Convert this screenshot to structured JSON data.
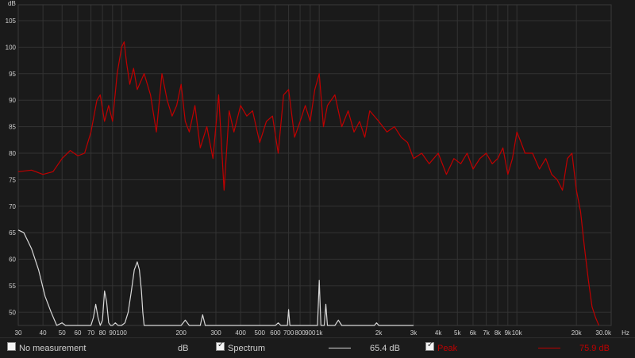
{
  "chart_data": {
    "type": "line",
    "xscale": "log",
    "xlim": [
      30,
      30000
    ],
    "ylim": [
      47.5,
      108
    ],
    "yunit": "dB",
    "xunit": "Hz",
    "grid": true,
    "xticks": [
      {
        "v": 30,
        "label": "30"
      },
      {
        "v": 40,
        "label": "40"
      },
      {
        "v": 50,
        "label": "50"
      },
      {
        "v": 60,
        "label": "60"
      },
      {
        "v": 70,
        "label": "70"
      },
      {
        "v": 80,
        "label": "80"
      },
      {
        "v": 90,
        "label": "90"
      },
      {
        "v": 100,
        "label": "100"
      },
      {
        "v": 200,
        "label": "200"
      },
      {
        "v": 300,
        "label": "300"
      },
      {
        "v": 400,
        "label": "400"
      },
      {
        "v": 500,
        "label": "500"
      },
      {
        "v": 600,
        "label": "600"
      },
      {
        "v": 700,
        "label": "700"
      },
      {
        "v": 800,
        "label": "800"
      },
      {
        "v": 900,
        "label": "900"
      },
      {
        "v": 1000,
        "label": "1k"
      },
      {
        "v": 2000,
        "label": "2k"
      },
      {
        "v": 3000,
        "label": "3k"
      },
      {
        "v": 4000,
        "label": "4k"
      },
      {
        "v": 5000,
        "label": "5k"
      },
      {
        "v": 6000,
        "label": "6k"
      },
      {
        "v": 7000,
        "label": "7k"
      },
      {
        "v": 8000,
        "label": "8k"
      },
      {
        "v": 9000,
        "label": "9k"
      },
      {
        "v": 10000,
        "label": "10k"
      },
      {
        "v": 20000,
        "label": "20k"
      },
      {
        "v": 30000,
        "label": "30.0k"
      }
    ],
    "yticks": [
      50,
      55,
      60,
      65,
      70,
      75,
      80,
      85,
      90,
      95,
      100,
      105
    ],
    "series": [
      {
        "name": "Peak",
        "color": "#c00000",
        "x": [
          30,
          35,
          40,
          45,
          50,
          55,
          60,
          65,
          70,
          75,
          78,
          82,
          86,
          90,
          95,
          100,
          103,
          106,
          110,
          115,
          120,
          130,
          140,
          150,
          160,
          170,
          180,
          190,
          200,
          210,
          220,
          235,
          250,
          270,
          290,
          310,
          330,
          350,
          370,
          400,
          430,
          460,
          500,
          540,
          580,
          620,
          660,
          700,
          750,
          800,
          850,
          900,
          950,
          1000,
          1050,
          1100,
          1200,
          1300,
          1400,
          1500,
          1600,
          1700,
          1800,
          2000,
          2200,
          2400,
          2600,
          2800,
          3000,
          3300,
          3600,
          4000,
          4400,
          4800,
          5200,
          5600,
          6000,
          6500,
          7000,
          7500,
          8000,
          8500,
          9000,
          9500,
          10000,
          10500,
          11000,
          12000,
          13000,
          14000,
          15000,
          16000,
          17000,
          18000,
          19000,
          20000,
          21000,
          22000,
          23000,
          24000,
          25000,
          26000
        ],
        "y": [
          76.5,
          76.8,
          76,
          76.5,
          79,
          80.5,
          79.5,
          80,
          84,
          90,
          91,
          86,
          89,
          86,
          95,
          100,
          101,
          97,
          93,
          96,
          92,
          95,
          91,
          84,
          95,
          90,
          87,
          89,
          93,
          86,
          84,
          89,
          81,
          85,
          79,
          91,
          73,
          88,
          84,
          89,
          87,
          88,
          82,
          86,
          87,
          80,
          91,
          92,
          83,
          86,
          89,
          86,
          92,
          95,
          85,
          89,
          91,
          85,
          88,
          84,
          86,
          83,
          88,
          86,
          84,
          85,
          83,
          82,
          79,
          80,
          78,
          80,
          76,
          79,
          78,
          80,
          77,
          79,
          80,
          78,
          79,
          81,
          76,
          79,
          84,
          82,
          80,
          80,
          77,
          79,
          76,
          75,
          73,
          79,
          80,
          73,
          69,
          62,
          56,
          51,
          49,
          47.5
        ]
      },
      {
        "name": "Spectrum",
        "color": "#d8d8d8",
        "x": [
          30,
          32,
          35,
          38,
          41,
          44,
          47,
          50,
          52,
          55,
          58,
          62,
          66,
          70,
          72,
          74,
          76,
          78,
          80,
          82,
          84,
          86,
          88,
          90,
          93,
          96,
          100,
          104,
          108,
          112,
          116,
          120,
          123,
          126,
          128,
          130,
          133,
          136,
          140,
          150,
          200,
          210,
          220,
          230,
          250,
          257,
          265,
          300,
          600,
          620,
          640,
          690,
          700,
          710,
          980,
          1000,
          1020,
          1060,
          1080,
          1100,
          1200,
          1250,
          1300,
          1900,
          1950,
          2000,
          2050,
          3000
        ],
        "y": [
          65.5,
          65,
          62,
          58,
          53,
          50,
          47.5,
          48,
          47.5,
          47.5,
          47.5,
          47.5,
          47.5,
          47.5,
          49,
          51.5,
          49,
          47.5,
          48.5,
          54,
          52,
          48,
          47.5,
          47.5,
          48,
          47.5,
          47.5,
          48,
          50,
          54,
          58,
          59.5,
          58,
          54,
          50,
          47.5,
          47.5,
          47.5,
          47.5,
          47.5,
          47.5,
          48.5,
          47.5,
          47.5,
          47.5,
          49.5,
          47.5,
          47.5,
          47.5,
          48,
          47.5,
          47.5,
          50.5,
          47.5,
          47.5,
          56,
          47.5,
          47.5,
          51.5,
          47.5,
          47.5,
          48.5,
          47.5,
          47.5,
          48,
          47.5,
          47.5,
          47.5
        ]
      }
    ]
  },
  "legend": {
    "no_measurement_label": "No measurement",
    "unit_label": "dB",
    "spectrum_label": "Spectrum",
    "spectrum_value": "65.4 dB",
    "peak_label": "Peak",
    "peak_value": "75.9 dB",
    "spectrum_color": "#d8d8d8",
    "peak_color": "#c00000"
  },
  "axis_labels": {
    "y_unit": "dB",
    "x_unit": "Hz"
  }
}
